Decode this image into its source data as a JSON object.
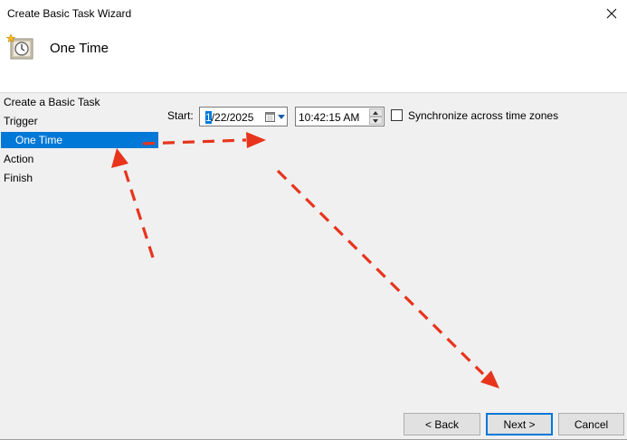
{
  "window": {
    "title": "Create Basic Task Wizard"
  },
  "header": {
    "title": "One Time",
    "icon": "task-clock-icon"
  },
  "sidebar": {
    "items": [
      {
        "label": "Create a Basic Task"
      },
      {
        "label": "Trigger"
      },
      {
        "label": "One Time",
        "selected": true
      },
      {
        "label": "Action"
      },
      {
        "label": "Finish"
      }
    ]
  },
  "trigger": {
    "start_label": "Start:",
    "date_value_selected": "1",
    "date_value_rest": "/22/2025",
    "time_value": "10:42:15 AM",
    "sync_label": "Synchronize across time zones",
    "sync_checked": false
  },
  "buttons": {
    "back": "< Back",
    "next": "Next >",
    "cancel": "Cancel"
  },
  "colors": {
    "selection": "#0078d7",
    "annotation_arrow": "#e8341c"
  }
}
